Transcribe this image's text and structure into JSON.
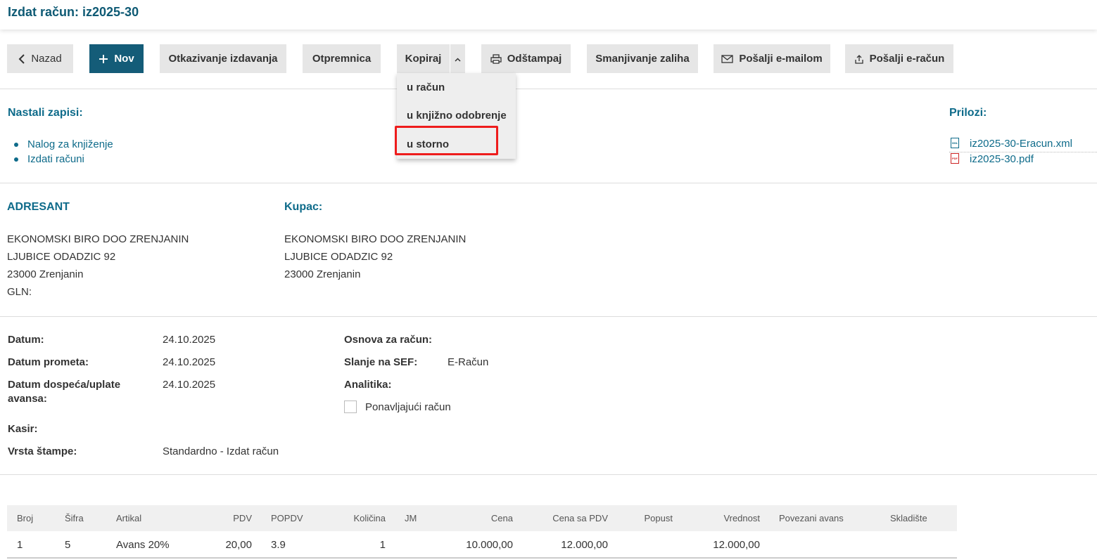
{
  "header": {
    "title": "Izdat račun: iz2025-30"
  },
  "toolbar": {
    "back": "Nazad",
    "new": "Nov",
    "cancel_issue": "Otkazivanje izdavanja",
    "delivery_note": "Otpremnica",
    "copy": "Kopiraj",
    "print": "Odštampaj",
    "reduce_stock": "Smanjivanje zaliha",
    "send_email": "Pošalji e-mailom",
    "send_einvoice": "Pošalji e-račun"
  },
  "copy_menu": {
    "items": [
      "u račun",
      "u knjižno odobrenje",
      "u storno"
    ],
    "highlighted": "u storno",
    "highlight_color": "#ee1c1c"
  },
  "records": {
    "title": "Nastali zapisi:",
    "items": [
      "Nalog za knjiženje",
      "Izdati računi"
    ]
  },
  "attachments": {
    "title": "Prilozi:",
    "files": [
      {
        "name": "iz2025-30-Eracun.xml",
        "icon": "xml-file-icon",
        "badge": "XML"
      },
      {
        "name": "iz2025-30.pdf",
        "icon": "pdf-file-icon",
        "badge": "PDF"
      }
    ]
  },
  "sender": {
    "title": "ADRESANT",
    "name": "EKONOMSKI BIRO DOO ZRENJANIN",
    "street": "LJUBICE ODADZIC 92",
    "city": "23000 Zrenjanin",
    "gln_label": "GLN:"
  },
  "buyer": {
    "title": "Kupac:",
    "name": "EKONOMSKI BIRO DOO ZRENJANIN",
    "street": "LJUBICE ODADZIC 92",
    "city": "23000 Zrenjanin"
  },
  "details": {
    "date_label": "Datum:",
    "date": "24.10.2025",
    "turnover_date_label": "Datum prometa:",
    "turnover_date": "24.10.2025",
    "due_date_label_1": "Datum dospeća/uplate",
    "due_date_label_2": "avansa:",
    "due_date": "24.10.2025",
    "cashier_label": "Kasir:",
    "print_type_label": "Vrsta štampe:",
    "print_type": "Standardno - Izdat račun",
    "basis_label": "Osnova za račun:",
    "sef_label": "Slanje na SEF:",
    "sef": "E-Račun",
    "analytics_label": "Analitika:",
    "recurring_label": "Ponavljajući račun",
    "recurring_checked": false
  },
  "table": {
    "headers": [
      "Broj",
      "Šifra",
      "Artikal",
      "PDV",
      "POPDV",
      "Količina",
      "JM",
      "Cena",
      "Cena sa PDV",
      "Popust",
      "Vrednost",
      "Povezani avans",
      "Skladište"
    ],
    "rows": [
      [
        "1",
        "5",
        "Avans 20%",
        "20,00",
        "3.9",
        "1",
        "",
        "10.000,00",
        "12.000,00",
        "",
        "12.000,00",
        "",
        ""
      ]
    ]
  },
  "colors": {
    "accent": "#0e6b8a",
    "primary_button": "#145c78",
    "button_bg": "#e6e6e6"
  }
}
